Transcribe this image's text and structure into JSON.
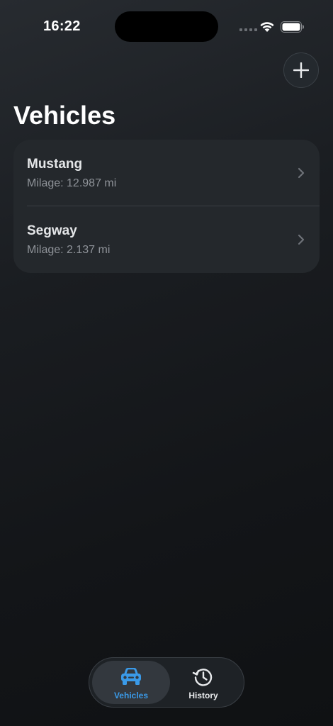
{
  "status_bar": {
    "time": "16:22"
  },
  "toolbar": {
    "add_icon": "plus-icon"
  },
  "page": {
    "title": "Vehicles"
  },
  "vehicles": [
    {
      "name": "Mustang",
      "mileage": "Milage: 12.987 mi"
    },
    {
      "name": "Segway",
      "mileage": "Milage: 2.137 mi"
    }
  ],
  "tab_bar": {
    "tabs": [
      {
        "label": "Vehicles",
        "icon": "car-icon",
        "active": true
      },
      {
        "label": "History",
        "icon": "history-clock-icon",
        "active": false
      }
    ]
  },
  "colors": {
    "accent": "#3a9ae8",
    "background": "#1a1d21",
    "card": "#24282c"
  }
}
